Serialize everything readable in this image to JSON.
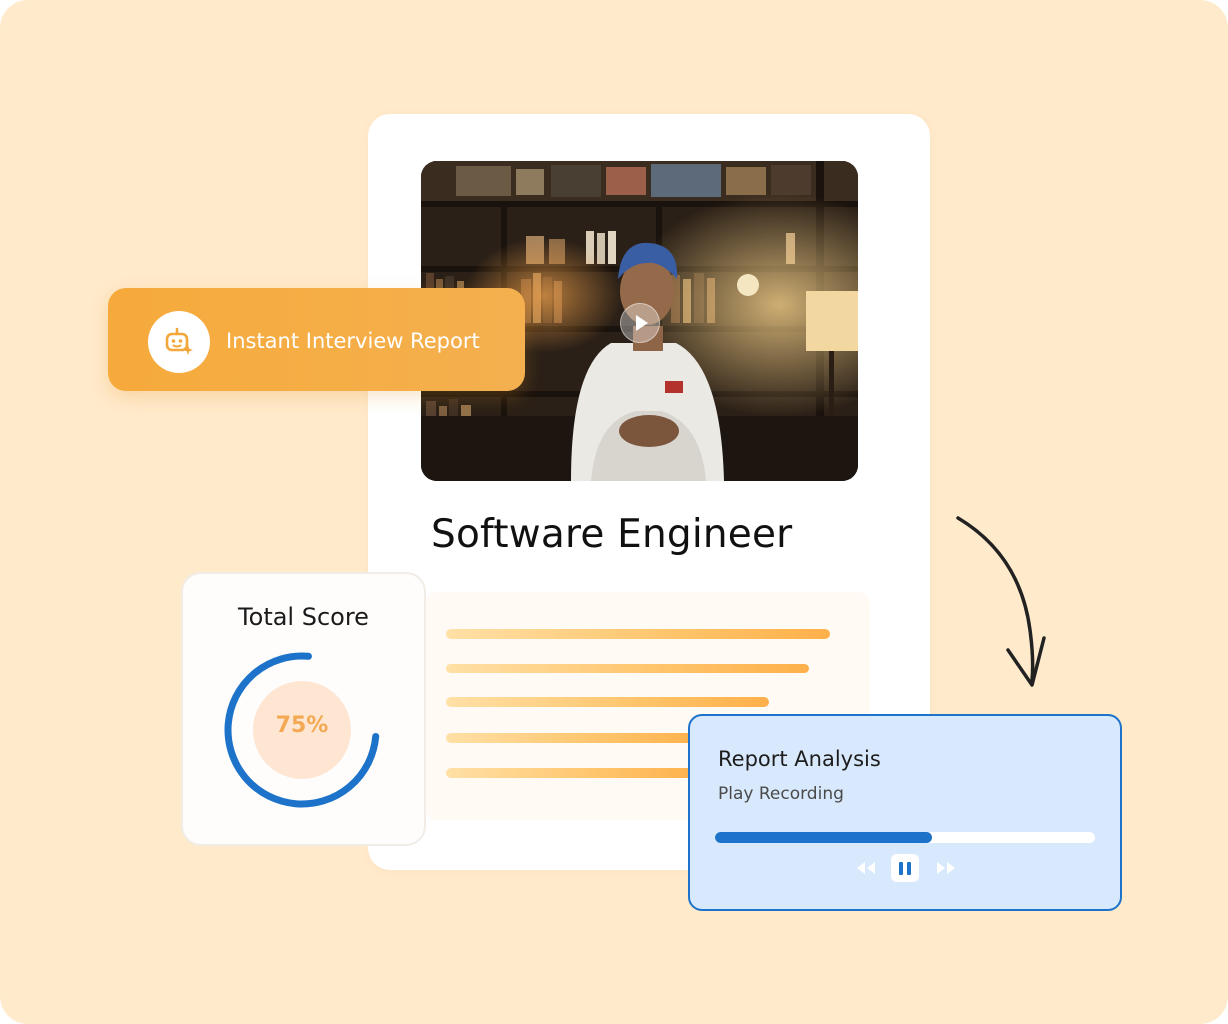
{
  "badge": {
    "label": "Instant Interview Report",
    "icon": "ai-bot-sparkle-icon"
  },
  "video": {
    "thumbnail": "interview-recording-thumbnail",
    "play_icon": "play-icon"
  },
  "job": {
    "title": "Software Engineer"
  },
  "score": {
    "title": "Total Score",
    "value_text": "75%",
    "value": 75
  },
  "analysis": {
    "title": "Report Analysis",
    "subtitle": "Play Recording",
    "progress": 0.57,
    "controls": [
      "rewind-icon",
      "pause-icon",
      "fast-forward-icon"
    ]
  },
  "colors": {
    "background": "#FFEACB",
    "accent_orange": "#F6AA3B",
    "accent_blue": "#1D73C9",
    "analysis_bg": "#D9E9FD"
  }
}
